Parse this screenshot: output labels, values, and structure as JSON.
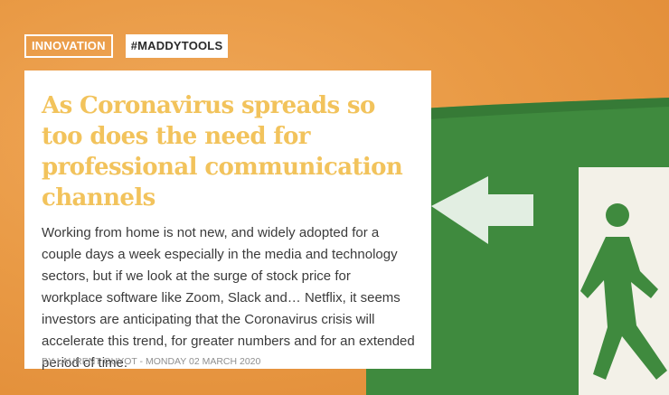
{
  "article": {
    "tags": [
      "Innovation",
      "#maddytools"
    ],
    "headline": "As Coronavirus spreads so too does the need for professional communication channels",
    "excerpt": "Working from home is not new, and widely adopted for a couple days a week especially in the media and technology sectors, but if we look at the surge of stock price for workplace software like Zoom, Slack and… Netflix, it seems investors are anticipating that the Coronavirus crisis will accelerate this trend, for greater numbers and for an extended period of time.",
    "byline": "By Laurent Guyot - Monday 02 March 2020"
  },
  "image": {
    "subject": "exit-sign-icon",
    "colors": {
      "background": "#e99a45",
      "sign": "#3f8a3e",
      "figure": "#ffffff"
    }
  }
}
